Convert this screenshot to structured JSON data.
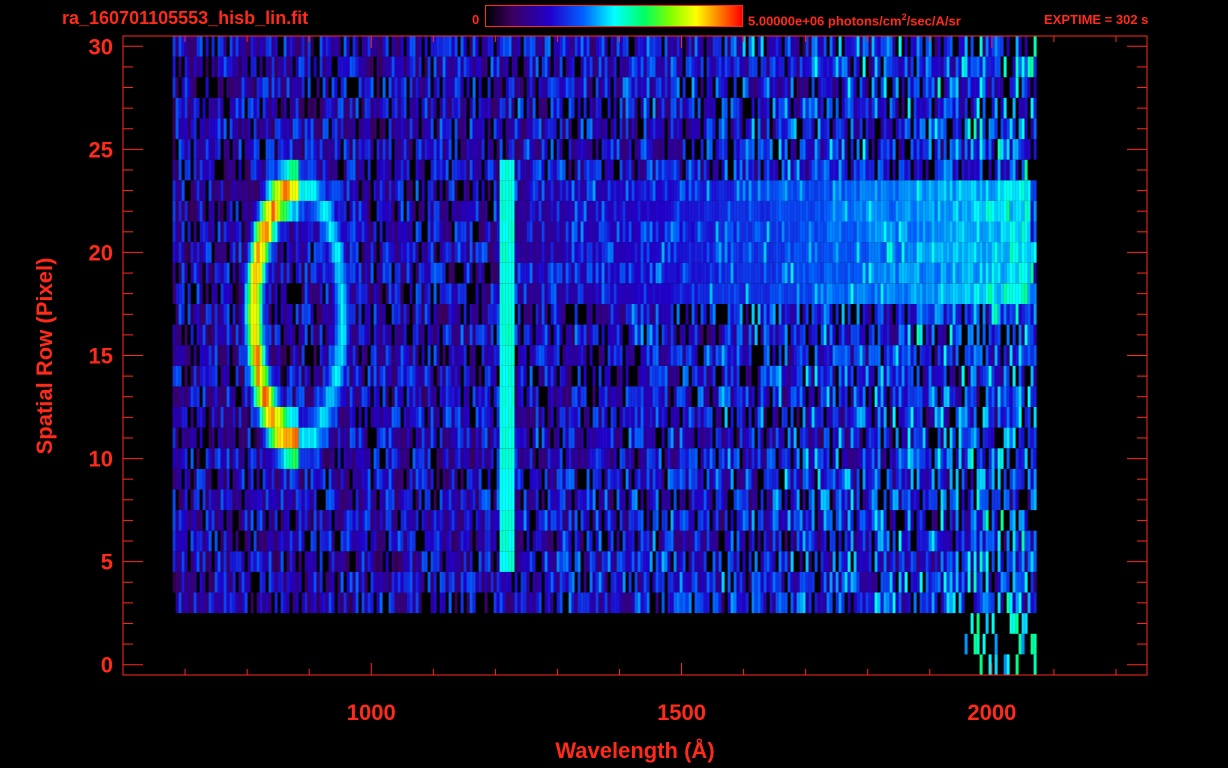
{
  "header": {
    "filename": "ra_160701105553_hisb_lin.fit",
    "colorbar_min": "0",
    "colorbar_max_prefix": "5.00000e+06 photons/cm",
    "colorbar_max_sup": "2",
    "colorbar_max_suffix": "/sec/A/sr",
    "exptime": "EXPTIME = 302 s"
  },
  "colors": {
    "axis": "#ff2a1a",
    "background": "#000000"
  },
  "chart_data": {
    "type": "heatmap",
    "title": "ra_160701105553_hisb_lin.fit",
    "xlabel": "Wavelength (Å)",
    "ylabel": "Spatial Row (Pixel)",
    "xlim": [
      600,
      2250
    ],
    "ylim": [
      -0.5,
      30.5
    ],
    "x_ticks": [
      "1000",
      "1500",
      "2000"
    ],
    "y_ticks": [
      "0",
      "5",
      "10",
      "15",
      "20",
      "25",
      "30"
    ],
    "colorbar": {
      "min": 0,
      "max": 5000000,
      "units": "photons/cm^2/sec/A/sr"
    },
    "colormap": "rainbow",
    "features": [
      {
        "type": "ring",
        "x_center": 880,
        "y_center": 17,
        "x_radius_A": 75,
        "y_radius_rows": 6.5,
        "peak_level": 0.95
      },
      {
        "type": "vertical_line",
        "x": 1216,
        "y_range": [
          5,
          24
        ],
        "level": 0.5
      },
      {
        "type": "continuum_band",
        "x_range": [
          1200,
          2060
        ],
        "y_range": [
          18,
          23
        ],
        "level_min": 0.15,
        "level_max": 0.55
      },
      {
        "type": "detector_region",
        "x_range": [
          680,
          2070
        ],
        "y_range": [
          3,
          30
        ]
      }
    ]
  }
}
